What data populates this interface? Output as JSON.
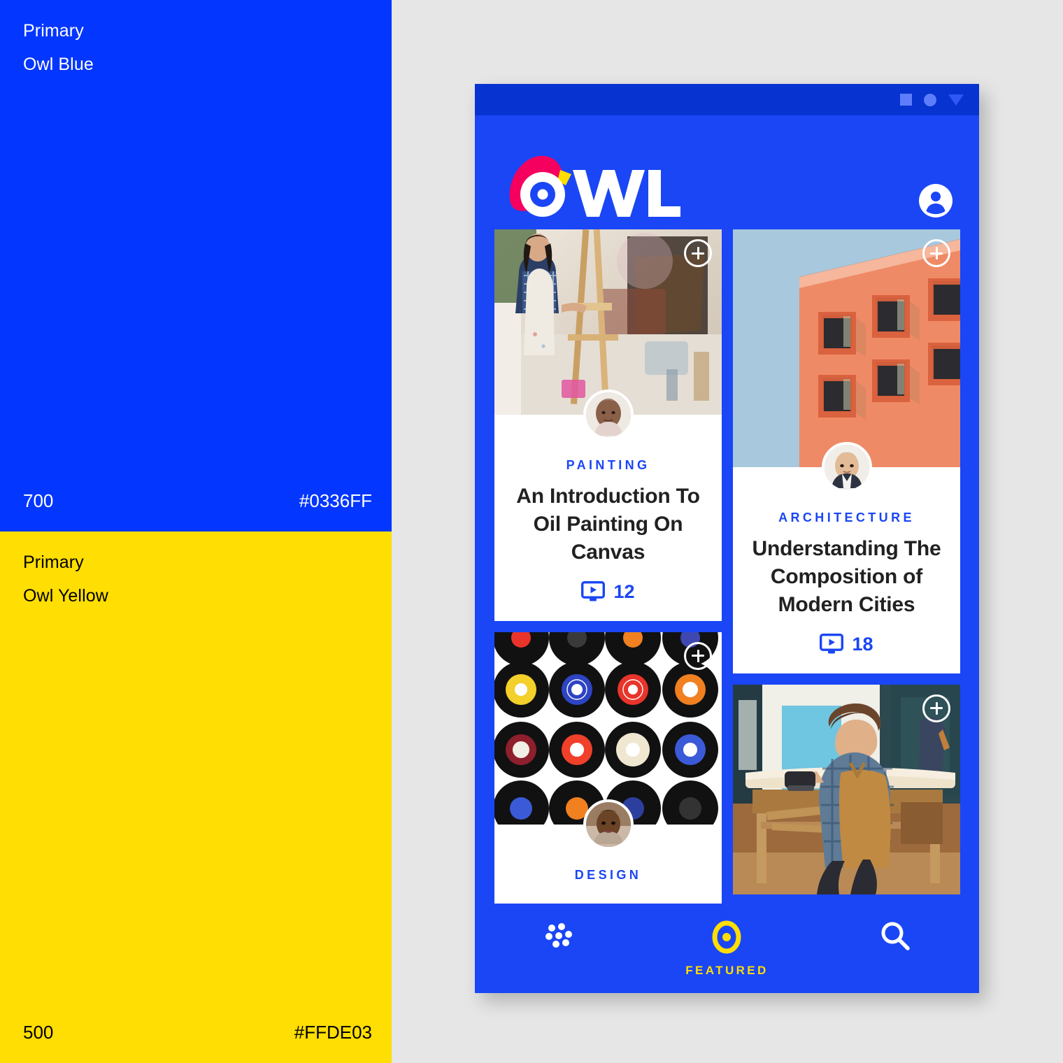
{
  "palette": {
    "swatches": [
      {
        "role": "Primary",
        "name": "Owl Blue",
        "weight": "700",
        "hex": "#0336FF"
      },
      {
        "role": "Primary",
        "name": "Owl Yellow",
        "weight": "500",
        "hex": "#FFDE03"
      }
    ]
  },
  "phone": {
    "statusbar": {
      "icons": [
        "square-icon",
        "circle-icon",
        "triangle-down-icon"
      ]
    },
    "appbar": {
      "brand": "OWL",
      "account_icon": "account-circle-icon"
    },
    "cards": [
      {
        "category": "PAINTING",
        "title": "An Introduction To Oil Painting On Canvas",
        "video_count": "12",
        "add_icon": "plus-circle-icon",
        "video_icon": "video-monitor-icon",
        "image": "woman-painting-on-easel-in-studio",
        "avatar": "instructor-avatar"
      },
      {
        "category": "ARCHITECTURE",
        "title": "Understanding The Composition of Modern Cities",
        "video_count": "18",
        "add_icon": "plus-circle-icon",
        "video_icon": "video-monitor-icon",
        "image": "orange-apartment-building-against-blue-sky",
        "avatar": "instructor-avatar"
      },
      {
        "category": "DESIGN",
        "title": "",
        "video_count": "",
        "add_icon": "plus-circle-icon",
        "image": "grid-of-vinyl-records",
        "avatar": "instructor-avatar"
      },
      {
        "category": "",
        "title": "",
        "video_count": "",
        "add_icon": "plus-circle-icon",
        "image": "carpenter-planing-wood-in-workshop",
        "avatar": ""
      }
    ],
    "bottomnav": {
      "items": [
        {
          "icon": "dots-grid-icon",
          "label": ""
        },
        {
          "icon": "owl-eye-icon",
          "label": "FEATURED"
        },
        {
          "icon": "search-icon",
          "label": ""
        }
      ]
    }
  }
}
